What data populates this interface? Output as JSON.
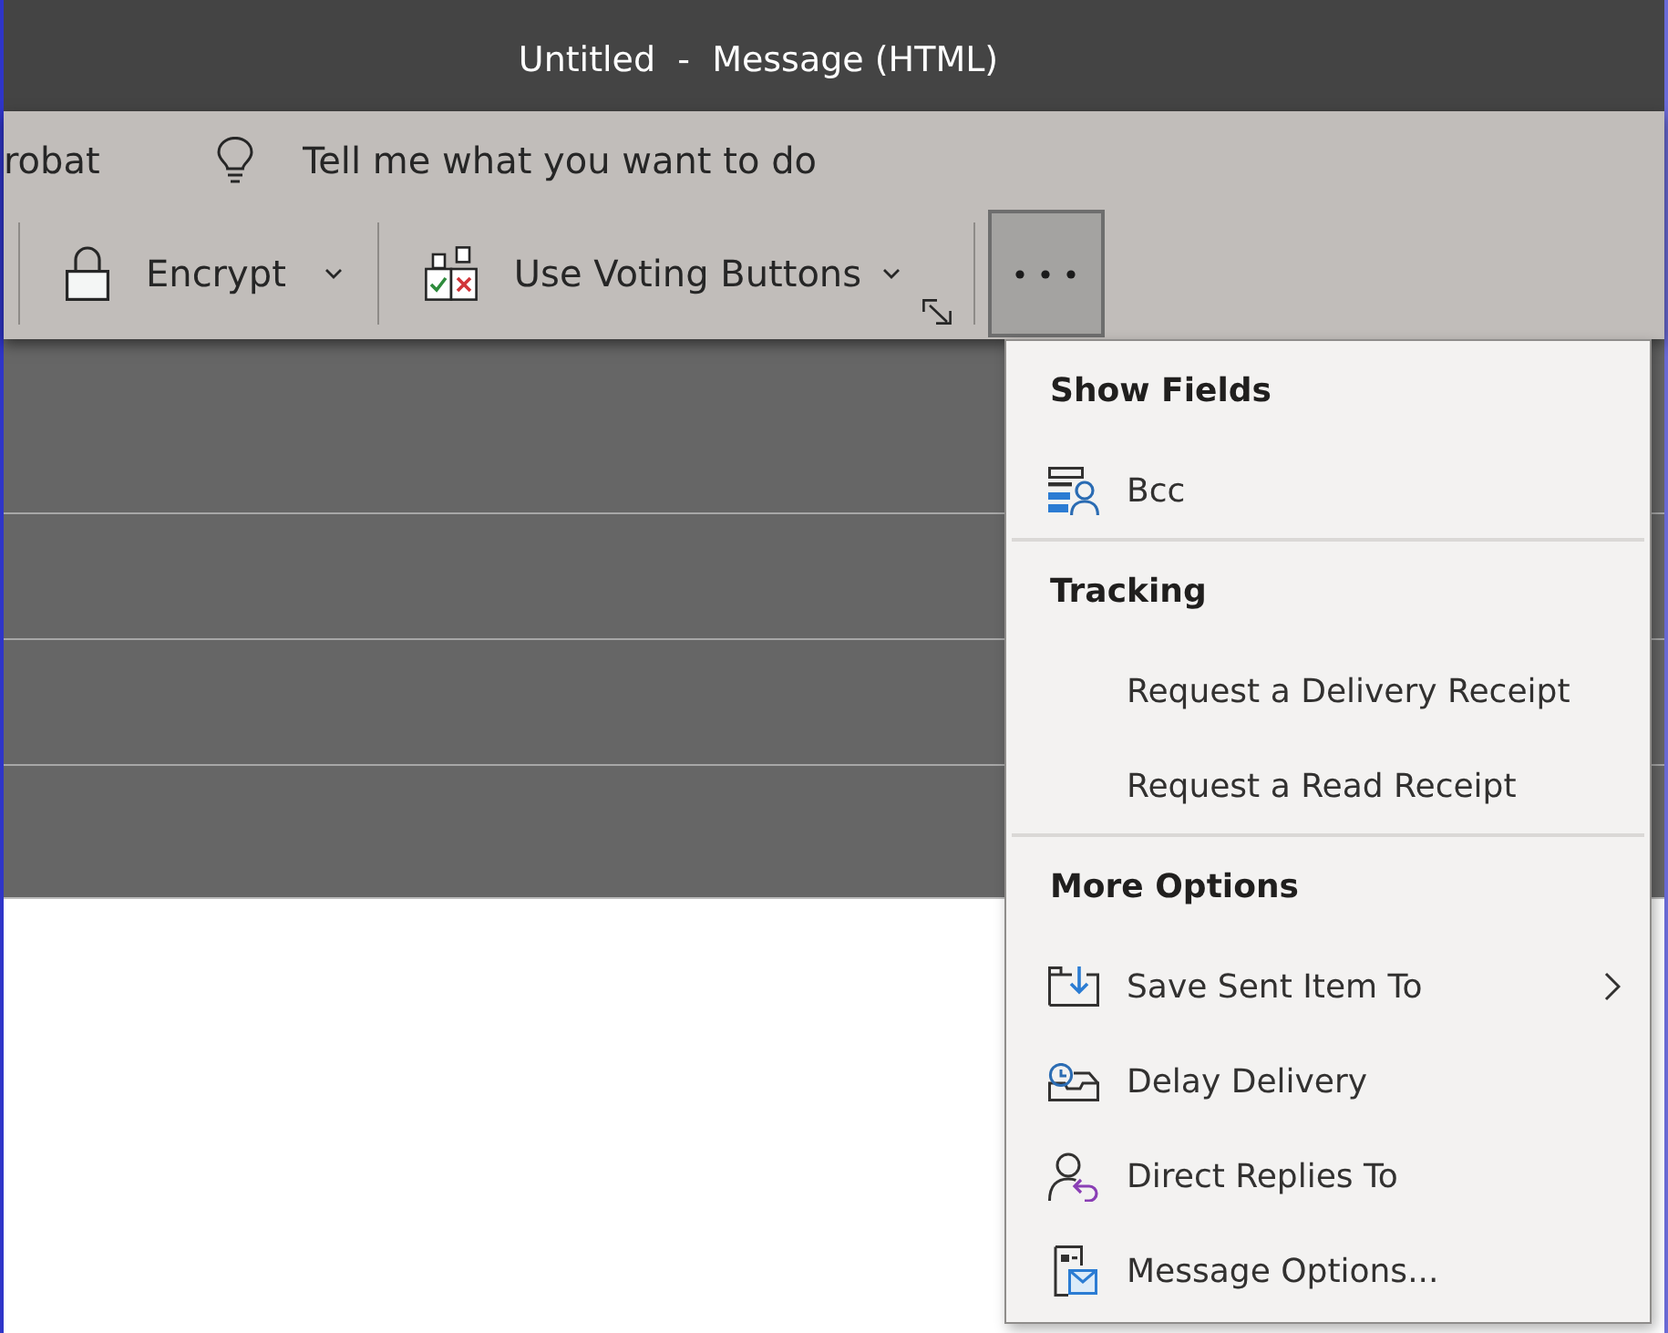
{
  "window": {
    "title": "Untitled  -  Message (HTML)"
  },
  "ribbon": {
    "tabs": [
      {
        "label": "robat",
        "selected": false
      }
    ],
    "tell_me": {
      "placeholder": "Tell me what you want to do"
    },
    "commands": [
      {
        "kind": "split",
        "label": "Encrypt"
      },
      {
        "kind": "split",
        "label": "Use Voting Buttons"
      },
      {
        "kind": "overflow",
        "expanded": true
      }
    ]
  },
  "overflow_menu": {
    "sections": [
      {
        "heading": "Show Fields",
        "items": [
          {
            "label": "Bcc",
            "submenu": false
          }
        ]
      },
      {
        "heading": "Tracking",
        "items": [
          {
            "label": "Request a Delivery Receipt",
            "checked": false,
            "submenu": false
          },
          {
            "label": "Request a Read Receipt",
            "checked": false,
            "submenu": false
          }
        ]
      },
      {
        "heading": "More Options",
        "items": [
          {
            "label": "Save Sent Item To",
            "submenu": true
          },
          {
            "label": "Delay Delivery",
            "submenu": false
          },
          {
            "label": "Direct Replies To",
            "submenu": false
          },
          {
            "label": "Message Options...",
            "submenu": false
          }
        ]
      }
    ]
  }
}
